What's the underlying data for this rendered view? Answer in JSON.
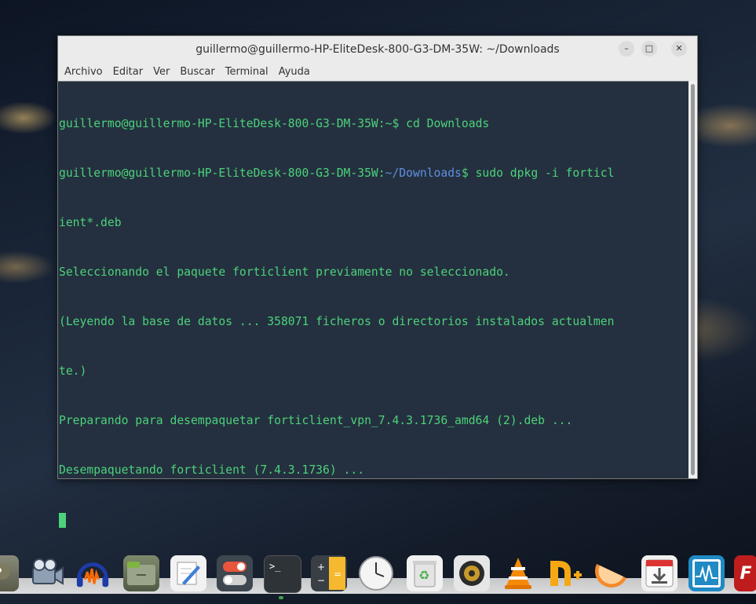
{
  "window": {
    "title": "guillermo@guillermo-HP-EliteDesk-800-G3-DM-35W: ~/Downloads",
    "minimize_icon": "minimize-icon",
    "maximize_icon": "maximize-icon",
    "close_icon": "close-icon"
  },
  "menu": [
    "Archivo",
    "Editar",
    "Ver",
    "Buscar",
    "Terminal",
    "Ayuda"
  ],
  "terminal": {
    "line1_prompt": "guillermo@guillermo-HP-EliteDesk-800-G3-DM-35W:~$",
    "line1_cmd": " cd Downloads",
    "line2_prompt": "guillermo@guillermo-HP-EliteDesk-800-G3-DM-35W:",
    "line2_path": "~/Downloads",
    "line2_cmd": "$ sudo dpkg -i forticl",
    "line3": "ient*.deb",
    "line4": "Seleccionando el paquete forticlient previamente no seleccionado.",
    "line5": "(Leyendo la base de datos ... 358071 ficheros o directorios instalados actualmen",
    "line6": "te.)",
    "line7": "Preparando para desempaquetar forticlient_vpn_7.4.3.1736_amd64 (2).deb ...",
    "line8": "Desempaquetando forticlient (7.4.3.1736) ..."
  },
  "dock": {
    "icons": [
      "gimp-icon",
      "media-maker-icon",
      "audacity-icon",
      "files-icon",
      "text-editor-icon",
      "settings-toggle-icon",
      "terminal-icon",
      "calculator-icon",
      "clock-icon",
      "trash-icon",
      "speaker-icon",
      "vlc-icon",
      "font-manager-icon",
      "orange-icon",
      "downloader-icon",
      "system-monitor-icon",
      "filezilla-icon"
    ]
  }
}
